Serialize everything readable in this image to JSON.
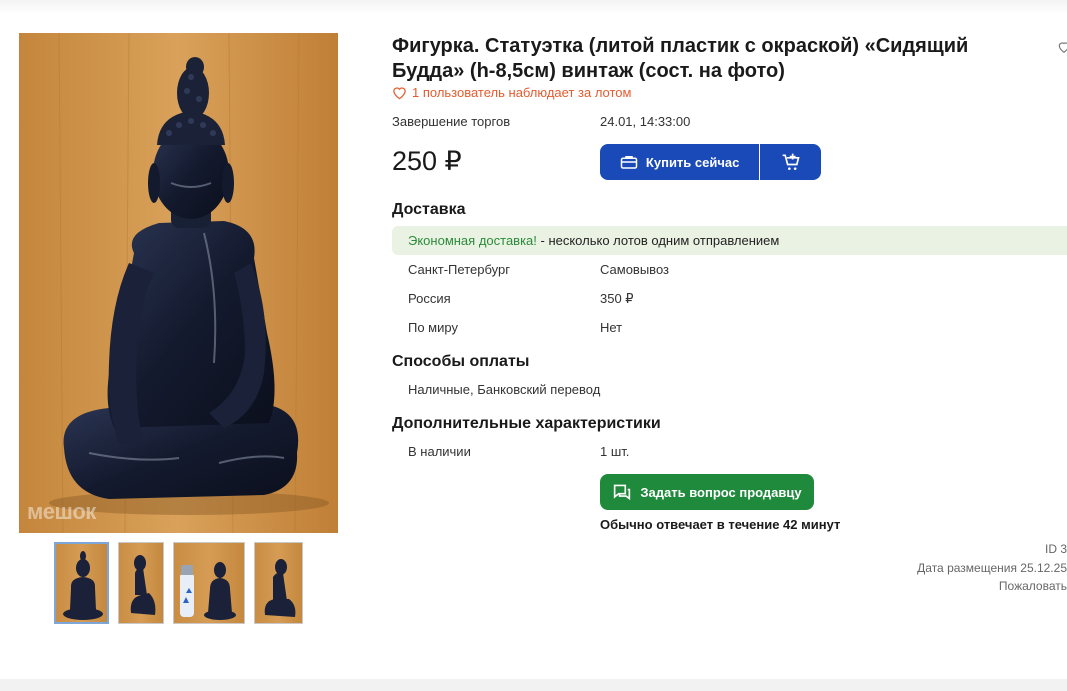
{
  "lot": {
    "title": "Фигурка. Статуэтка (литой пластик с окраской) «Сидящий Будда» (h-8,5см) винтаж (сост. на фото)",
    "watchers": "1 пользователь наблюдает за лотом",
    "end_label": "Завершение торгов",
    "end_value": "24.01, 14:33:00",
    "price": "250 ₽",
    "buy_now": "Купить сейчас"
  },
  "gallery": {
    "watermark": "мешок",
    "thumbnails": [
      "photo-1",
      "photo-2",
      "photo-3",
      "photo-4"
    ]
  },
  "delivery": {
    "title": "Доставка",
    "eco_highlight": "Экономная доставка!",
    "eco_text": " - несколько лотов одним отправлением",
    "rows": [
      {
        "region": "Санкт-Петербург",
        "value": "Самовывоз"
      },
      {
        "region": "Россия",
        "value": "350 ₽"
      },
      {
        "region": "По миру",
        "value": "Нет"
      }
    ]
  },
  "payment": {
    "title": "Способы оплаты",
    "methods": "Наличные, Банковский перевод"
  },
  "extra": {
    "title": "Дополнительные характеристики",
    "stock_label": "В наличии",
    "stock_value": "1 шт."
  },
  "seller": {
    "ask_button": "Задать вопрос продавцу",
    "reply_note": "Обычно отвечает в течение 42 минут"
  },
  "meta": {
    "id": "ID 3",
    "posted": "Дата размещения 25.12.25",
    "report": "Пожаловать"
  },
  "colors": {
    "buy_button": "#1a49b8",
    "ask_button": "#1f8a3b",
    "watch_text": "#e55b2e",
    "eco_bg": "#eaf2e4",
    "eco_text": "#2c8b3a"
  },
  "icons": {
    "watch": "heart-icon",
    "buy": "briefcase-icon",
    "cart": "cart-plus-icon",
    "ask": "chat-icon",
    "corner": "heart-icon"
  }
}
